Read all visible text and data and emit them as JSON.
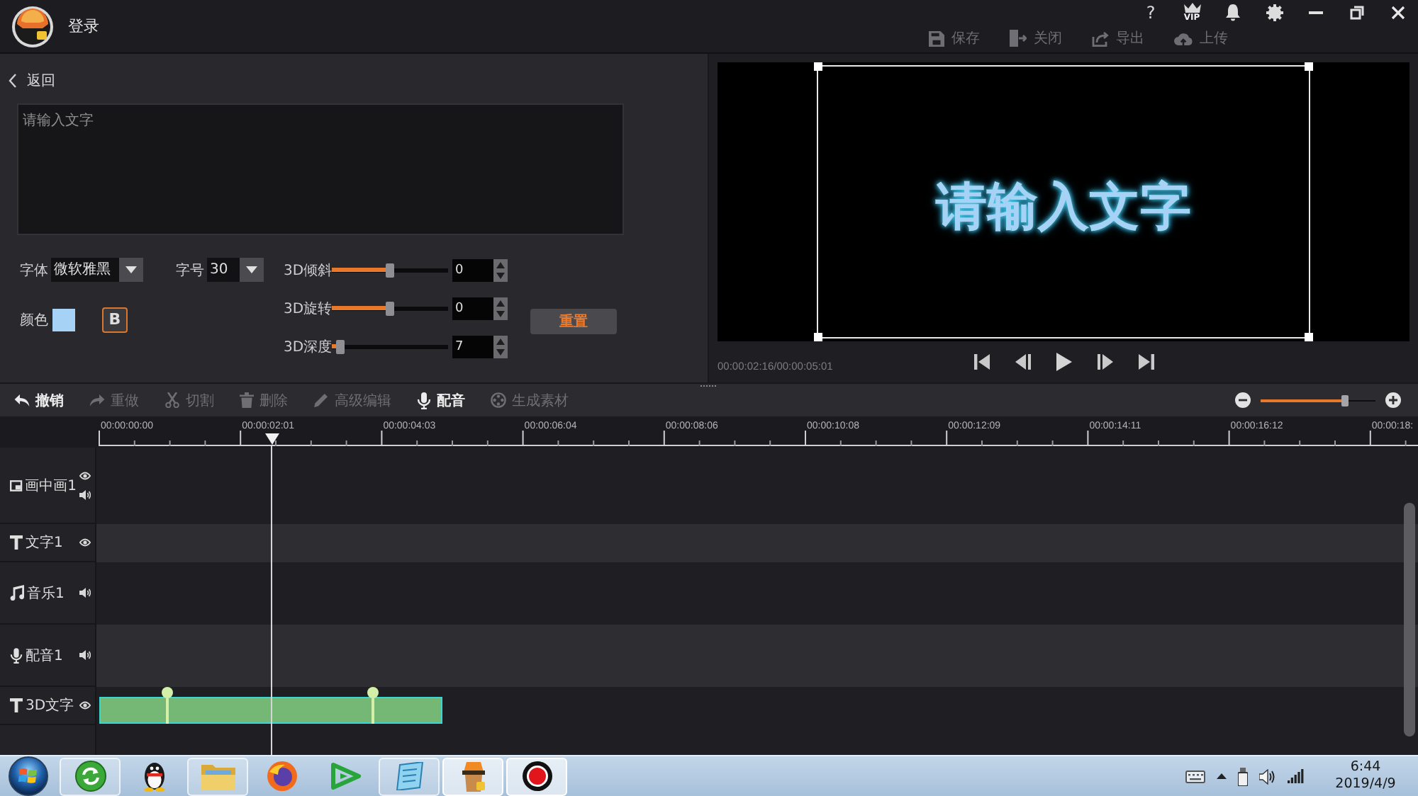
{
  "title_bar": {
    "title": "登录",
    "help": "?",
    "vip": "VIP",
    "actions": [
      {
        "kind": "save",
        "label": "保存",
        "disabled": true
      },
      {
        "kind": "close",
        "label": "关闭",
        "disabled": true
      },
      {
        "kind": "export",
        "label": "导出",
        "disabled": true
      },
      {
        "kind": "upload",
        "label": "上传",
        "disabled": true
      }
    ]
  },
  "editor": {
    "back": "返回",
    "text_input": {
      "placeholder": "请输入文字"
    },
    "font": {
      "label": "字体",
      "value": "微软雅黑"
    },
    "font_size": {
      "label": "字号",
      "value": "30"
    },
    "color": {
      "label": "颜色",
      "color": "#a6d3f5"
    },
    "bold": {
      "label": "B",
      "on": true
    },
    "sliders": [
      {
        "label": "3D倾斜",
        "level": 0.5,
        "value": "0"
      },
      {
        "label": "3D旋转",
        "level": 0.5,
        "value": "0"
      },
      {
        "label": "3D深度",
        "level": 0.07,
        "value": "7"
      }
    ],
    "reset": "重置"
  },
  "preview": {
    "text": "请输入文字",
    "timecode": "00:00:02:16/00:00:05:01"
  },
  "timeline_toolbar": {
    "tools": [
      {
        "kind": "undo",
        "label": "撤销",
        "disabled": false
      },
      {
        "kind": "redo",
        "label": "重做",
        "disabled": true
      },
      {
        "kind": "cut",
        "label": "切割",
        "disabled": true
      },
      {
        "kind": "delete",
        "label": "删除",
        "disabled": true
      },
      {
        "kind": "edit",
        "label": "高级编辑",
        "disabled": true
      },
      {
        "kind": "voice",
        "label": "配音",
        "disabled": false
      },
      {
        "kind": "generate",
        "label": "生成素材",
        "disabled": true
      }
    ],
    "zoom": {
      "level": 0.73
    }
  },
  "ruler": {
    "ticks": [
      "00:00:00:00",
      "00:00:02:01",
      "00:00:04:03",
      "00:00:06:04",
      "00:00:08:06",
      "00:00:10:08",
      "00:00:12:09",
      "00:00:14:11",
      "00:00:16:12",
      "00:00:18:"
    ]
  },
  "tracks": [
    {
      "kind": "pip",
      "label": "画中画1"
    },
    {
      "kind": "text",
      "label": "文字1"
    },
    {
      "kind": "music",
      "label": "音乐1"
    },
    {
      "kind": "voice",
      "label": "配音1"
    },
    {
      "kind": "text",
      "label": "3D文字",
      "clips": [
        {
          "selected": true
        }
      ]
    }
  ],
  "taskbar": {
    "apps": [
      {
        "kind": "circle_arrows",
        "running": true,
        "active": false
      },
      {
        "kind": "penguin",
        "running": false,
        "active": false
      },
      {
        "kind": "folder",
        "running": true,
        "active": false
      },
      {
        "kind": "globe",
        "running": false,
        "active": false
      },
      {
        "kind": "play",
        "running": false,
        "active": false
      },
      {
        "kind": "note",
        "running": true,
        "active": false
      },
      {
        "kind": "cup",
        "running": true,
        "active": true
      },
      {
        "kind": "record",
        "running": true,
        "active": true
      }
    ],
    "clock": {
      "time": "6:44",
      "date": "2019/4/9"
    }
  }
}
